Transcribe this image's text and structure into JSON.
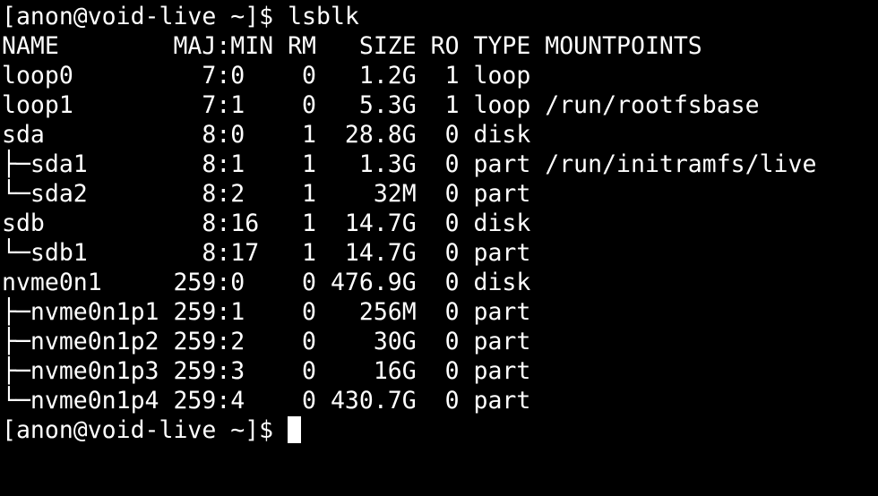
{
  "prompt": "[anon@void-live ~]$ ",
  "command": "lsblk",
  "output": [
    "NAME        MAJ:MIN RM   SIZE RO TYPE MOUNTPOINTS",
    "loop0         7:0    0   1.2G  1 loop",
    "loop1         7:1    0   5.3G  1 loop /run/rootfsbase",
    "sda           8:0    1  28.8G  0 disk",
    "├─sda1        8:1    1   1.3G  0 part /run/initramfs/live",
    "└─sda2        8:2    1    32M  0 part",
    "sdb           8:16   1  14.7G  0 disk",
    "└─sdb1        8:17   1  14.7G  0 part",
    "nvme0n1     259:0    0 476.9G  0 disk",
    "├─nvme0n1p1 259:1    0   256M  0 part",
    "├─nvme0n1p2 259:2    0    30G  0 part",
    "├─nvme0n1p3 259:3    0    16G  0 part",
    "└─nvme0n1p4 259:4    0 430.7G  0 part"
  ],
  "colors": {
    "background": "#000000",
    "foreground": "#ffffff"
  }
}
